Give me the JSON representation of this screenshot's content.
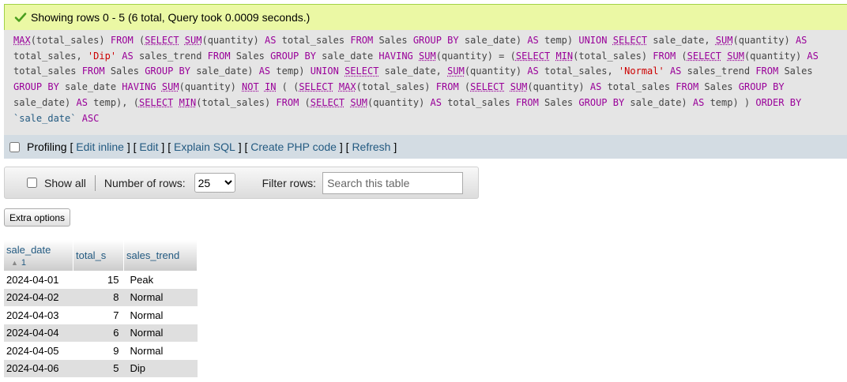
{
  "status": {
    "message": "Showing rows 0 - 5 (6 total, Query took 0.0009 seconds.)"
  },
  "profiling": {
    "label": "Profiling",
    "links": [
      "Edit inline",
      "Edit",
      "Explain SQL",
      "Create PHP code",
      "Refresh"
    ]
  },
  "nav": {
    "show_all_label": "Show all",
    "rows_label": "Number of rows:",
    "rows_value": "25",
    "filter_label": "Filter rows:",
    "filter_placeholder": "Search this table"
  },
  "extra_options_label": "Extra options",
  "table": {
    "headers": [
      "sale_date",
      "total_s",
      "sales_trend"
    ],
    "sort_order": "1",
    "rows": [
      [
        "2024-04-01",
        "15",
        "Peak"
      ],
      [
        "2024-04-02",
        "8",
        "Normal"
      ],
      [
        "2024-04-03",
        "7",
        "Normal"
      ],
      [
        "2024-04-04",
        "6",
        "Normal"
      ],
      [
        "2024-04-05",
        "9",
        "Normal"
      ],
      [
        "2024-04-06",
        "5",
        "Dip"
      ]
    ]
  },
  "sql_tokens": [
    [
      "fn",
      "MAX"
    ],
    [
      "id",
      "(total_sales) "
    ],
    [
      "kw",
      "FROM"
    ],
    [
      "id",
      " ("
    ],
    [
      "kwl",
      "SELECT"
    ],
    [
      "id",
      " "
    ],
    [
      "fn",
      "SUM"
    ],
    [
      "id",
      "(quantity) "
    ],
    [
      "kw",
      "AS"
    ],
    [
      "id",
      " total_sales "
    ],
    [
      "kw",
      "FROM"
    ],
    [
      "id",
      " Sales "
    ],
    [
      "kw",
      "GROUP BY"
    ],
    [
      "id",
      " sale_date) "
    ],
    [
      "kw",
      "AS"
    ],
    [
      "id",
      " temp) "
    ],
    [
      "kw",
      "UNION"
    ],
    [
      "id",
      " "
    ],
    [
      "kwl",
      "SELECT"
    ],
    [
      "id",
      " sale_date, "
    ],
    [
      "fn",
      "SUM"
    ],
    [
      "id",
      "(quantity) "
    ],
    [
      "kw",
      "AS"
    ],
    [
      "id",
      "\n"
    ],
    [
      "id",
      "total_sales, "
    ],
    [
      "str",
      "'Dip'"
    ],
    [
      "id",
      " "
    ],
    [
      "kw",
      "AS"
    ],
    [
      "id",
      " sales_trend "
    ],
    [
      "kw",
      "FROM"
    ],
    [
      "id",
      " Sales "
    ],
    [
      "kw",
      "GROUP BY"
    ],
    [
      "id",
      " sale_date "
    ],
    [
      "kw",
      "HAVING"
    ],
    [
      "id",
      " "
    ],
    [
      "fn",
      "SUM"
    ],
    [
      "id",
      "(quantity) = ("
    ],
    [
      "kwl",
      "SELECT"
    ],
    [
      "id",
      " "
    ],
    [
      "fn",
      "MIN"
    ],
    [
      "id",
      "(total_sales) "
    ],
    [
      "kw",
      "FROM"
    ],
    [
      "id",
      " ("
    ],
    [
      "kwl",
      "SELECT"
    ],
    [
      "id",
      " "
    ],
    [
      "fn",
      "SUM"
    ],
    [
      "id",
      "(quantity) "
    ],
    [
      "kw",
      "AS"
    ],
    [
      "id",
      "\n"
    ],
    [
      "id",
      "total_sales "
    ],
    [
      "kw",
      "FROM"
    ],
    [
      "id",
      " Sales "
    ],
    [
      "kw",
      "GROUP BY"
    ],
    [
      "id",
      " sale_date) "
    ],
    [
      "kw",
      "AS"
    ],
    [
      "id",
      " temp) "
    ],
    [
      "kw",
      "UNION"
    ],
    [
      "id",
      " "
    ],
    [
      "kwl",
      "SELECT"
    ],
    [
      "id",
      " sale_date, "
    ],
    [
      "fn",
      "SUM"
    ],
    [
      "id",
      "(quantity) "
    ],
    [
      "kw",
      "AS"
    ],
    [
      "id",
      " total_sales, "
    ],
    [
      "str",
      "'Normal'"
    ],
    [
      "id",
      " "
    ],
    [
      "kw",
      "AS"
    ],
    [
      "id",
      " sales_trend "
    ],
    [
      "kw",
      "FROM"
    ],
    [
      "id",
      " Sales\n"
    ],
    [
      "kw",
      "GROUP BY"
    ],
    [
      "id",
      " sale_date "
    ],
    [
      "kw",
      "HAVING"
    ],
    [
      "id",
      " "
    ],
    [
      "fn",
      "SUM"
    ],
    [
      "id",
      "(quantity) "
    ],
    [
      "kwl",
      "NOT"
    ],
    [
      "id",
      " "
    ],
    [
      "kwl",
      "IN"
    ],
    [
      "id",
      " ( ("
    ],
    [
      "kwl",
      "SELECT"
    ],
    [
      "id",
      " "
    ],
    [
      "fn",
      "MAX"
    ],
    [
      "id",
      "(total_sales) "
    ],
    [
      "kw",
      "FROM"
    ],
    [
      "id",
      " ("
    ],
    [
      "kwl",
      "SELECT"
    ],
    [
      "id",
      " "
    ],
    [
      "fn",
      "SUM"
    ],
    [
      "id",
      "(quantity) "
    ],
    [
      "kw",
      "AS"
    ],
    [
      "id",
      " total_sales "
    ],
    [
      "kw",
      "FROM"
    ],
    [
      "id",
      " Sales "
    ],
    [
      "kw",
      "GROUP BY"
    ],
    [
      "id",
      "\n"
    ],
    [
      "id",
      "sale_date) "
    ],
    [
      "kw",
      "AS"
    ],
    [
      "id",
      " temp), ("
    ],
    [
      "kwl",
      "SELECT"
    ],
    [
      "id",
      " "
    ],
    [
      "fn",
      "MIN"
    ],
    [
      "id",
      "(total_sales) "
    ],
    [
      "kw",
      "FROM"
    ],
    [
      "id",
      " ("
    ],
    [
      "kwl",
      "SELECT"
    ],
    [
      "id",
      " "
    ],
    [
      "fn",
      "SUM"
    ],
    [
      "id",
      "(quantity) "
    ],
    [
      "kw",
      "AS"
    ],
    [
      "id",
      " total_sales "
    ],
    [
      "kw",
      "FROM"
    ],
    [
      "id",
      " Sales "
    ],
    [
      "kw",
      "GROUP BY"
    ],
    [
      "id",
      " sale_date) "
    ],
    [
      "kw",
      "AS"
    ],
    [
      "id",
      " temp) ) "
    ],
    [
      "kw",
      "ORDER BY"
    ],
    [
      "id",
      "\n"
    ],
    [
      "bt",
      "`sale_date`"
    ],
    [
      "id",
      " "
    ],
    [
      "kw",
      "ASC"
    ]
  ],
  "colors": {
    "success_bg": "#ebf8a4",
    "link": "#235a81",
    "keyword": "#990099",
    "string": "#cc0000"
  }
}
